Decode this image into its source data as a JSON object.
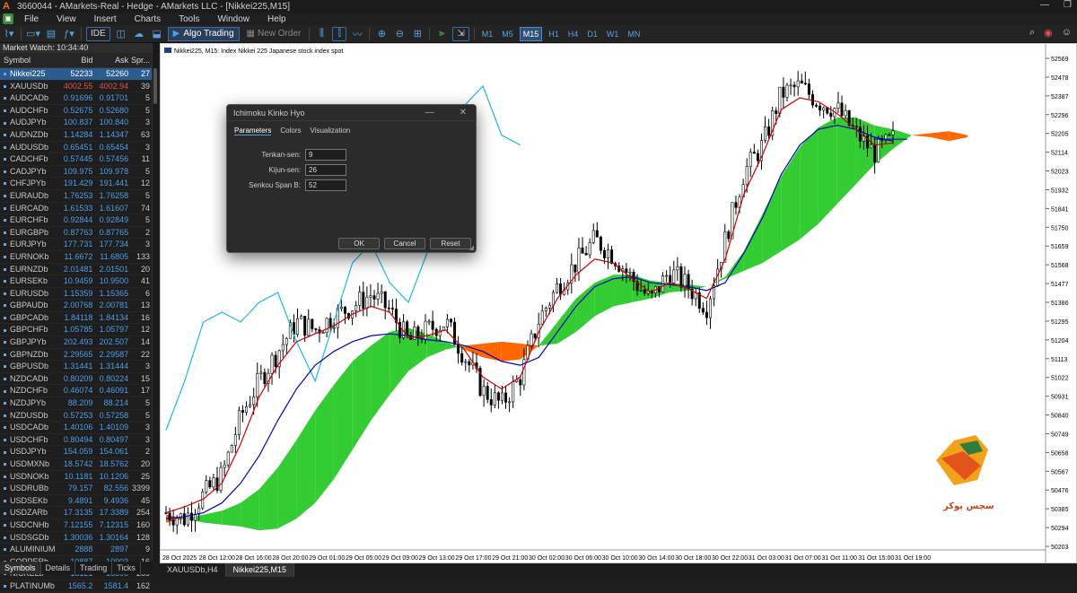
{
  "window": {
    "title": "3660044 - AMarkets-Real - Hedge - AMarkets LLC - [Nikkei225,M15]",
    "icon": "amarkets-logo-icon"
  },
  "menu": [
    "File",
    "View",
    "Insert",
    "Charts",
    "Tools",
    "Window",
    "Help"
  ],
  "toolbar": {
    "ide_label": "IDE",
    "algo_label": "Algo Trading",
    "new_order_label": "New Order",
    "timeframes": [
      "M1",
      "M5",
      "M15",
      "H1",
      "H4",
      "D1",
      "W1",
      "MN"
    ],
    "active_timeframe": "M15"
  },
  "market_watch": {
    "title": "Market Watch: 10:34:40",
    "columns": [
      "Symbol",
      "Bid",
      "Ask",
      "Spr..."
    ],
    "rows": [
      {
        "symbol": "Nikkei225",
        "bid": "52233",
        "ask": "52260",
        "spread": "27",
        "selected": true
      },
      {
        "symbol": "XAUUSDb",
        "bid": "4002.55",
        "ask": "4002.94",
        "spread": "39",
        "down": true
      },
      {
        "symbol": "AUDCADb",
        "bid": "0.91696",
        "ask": "0.91701",
        "spread": "5"
      },
      {
        "symbol": "AUDCHFb",
        "bid": "0.52675",
        "ask": "0.52680",
        "spread": "5"
      },
      {
        "symbol": "AUDJPYb",
        "bid": "100.837",
        "ask": "100.840",
        "spread": "3"
      },
      {
        "symbol": "AUDNZDb",
        "bid": "1.14284",
        "ask": "1.14347",
        "spread": "63"
      },
      {
        "symbol": "AUDUSDb",
        "bid": "0.65451",
        "ask": "0.65454",
        "spread": "3"
      },
      {
        "symbol": "CADCHFb",
        "bid": "0.57445",
        "ask": "0.57456",
        "spread": "11"
      },
      {
        "symbol": "CADJPYb",
        "bid": "109.975",
        "ask": "109.978",
        "spread": "5"
      },
      {
        "symbol": "CHFJPYb",
        "bid": "191.429",
        "ask": "191.441",
        "spread": "12"
      },
      {
        "symbol": "EURAUDb",
        "bid": "1.76253",
        "ask": "1.76258",
        "spread": "5"
      },
      {
        "symbol": "EURCADb",
        "bid": "1.61533",
        "ask": "1.61607",
        "spread": "74"
      },
      {
        "symbol": "EURCHFb",
        "bid": "0.92844",
        "ask": "0.92849",
        "spread": "5"
      },
      {
        "symbol": "EURGBPb",
        "bid": "0.87763",
        "ask": "0.87765",
        "spread": "2"
      },
      {
        "symbol": "EURJPYb",
        "bid": "177.731",
        "ask": "177.734",
        "spread": "3"
      },
      {
        "symbol": "EURNOKb",
        "bid": "11.6672",
        "ask": "11.6805",
        "spread": "133"
      },
      {
        "symbol": "EURNZDb",
        "bid": "2.01481",
        "ask": "2.01501",
        "spread": "20"
      },
      {
        "symbol": "EURSEKb",
        "bid": "10.9459",
        "ask": "10.9500",
        "spread": "41"
      },
      {
        "symbol": "EURUSDb",
        "bid": "1.15359",
        "ask": "1.15365",
        "spread": "6"
      },
      {
        "symbol": "GBPAUDb",
        "bid": "2.00768",
        "ask": "2.00781",
        "spread": "13"
      },
      {
        "symbol": "GBPCADb",
        "bid": "1.84118",
        "ask": "1.84134",
        "spread": "16"
      },
      {
        "symbol": "GBPCHFb",
        "bid": "1.05785",
        "ask": "1.05797",
        "spread": "12"
      },
      {
        "symbol": "GBPJPYb",
        "bid": "202.493",
        "ask": "202.507",
        "spread": "14"
      },
      {
        "symbol": "GBPNZDb",
        "bid": "2.29565",
        "ask": "2.29587",
        "spread": "22"
      },
      {
        "symbol": "GBPUSDb",
        "bid": "1.31441",
        "ask": "1.31444",
        "spread": "3"
      },
      {
        "symbol": "NZDCADb",
        "bid": "0.80209",
        "ask": "0.80224",
        "spread": "15"
      },
      {
        "symbol": "NZDCHFb",
        "bid": "0.46074",
        "ask": "0.46091",
        "spread": "17"
      },
      {
        "symbol": "NZDJPYb",
        "bid": "88.209",
        "ask": "88.214",
        "spread": "5"
      },
      {
        "symbol": "NZDUSDb",
        "bid": "0.57253",
        "ask": "0.57258",
        "spread": "5"
      },
      {
        "symbol": "USDCADb",
        "bid": "1.40106",
        "ask": "1.40109",
        "spread": "3"
      },
      {
        "symbol": "USDCHFb",
        "bid": "0.80494",
        "ask": "0.80497",
        "spread": "3"
      },
      {
        "symbol": "USDJPYb",
        "bid": "154.059",
        "ask": "154.061",
        "spread": "2"
      },
      {
        "symbol": "USDMXNb",
        "bid": "18.5742",
        "ask": "18.5762",
        "spread": "20"
      },
      {
        "symbol": "USDNOKb",
        "bid": "10.1181",
        "ask": "10.1206",
        "spread": "25"
      },
      {
        "symbol": "USDRUBb",
        "bid": "79.157",
        "ask": "82.556",
        "spread": "3399"
      },
      {
        "symbol": "USDSEKb",
        "bid": "9.4891",
        "ask": "9.4936",
        "spread": "45"
      },
      {
        "symbol": "USDZARb",
        "bid": "17.3135",
        "ask": "17.3389",
        "spread": "254"
      },
      {
        "symbol": "USDCNHb",
        "bid": "7.12155",
        "ask": "7.12315",
        "spread": "160"
      },
      {
        "symbol": "USDSGDb",
        "bid": "1.30036",
        "ask": "1.30164",
        "spread": "128"
      },
      {
        "symbol": "ALUMINIUMb",
        "bid": "2888",
        "ask": "2897",
        "spread": "9"
      },
      {
        "symbol": "COPPERb",
        "bid": "10887",
        "ask": "10903",
        "spread": "16"
      },
      {
        "symbol": "NICKELb",
        "bid": "15121",
        "ask": "15390",
        "spread": "269"
      },
      {
        "symbol": "PLATINUMb",
        "bid": "1565.2",
        "ask": "1581.4",
        "spread": "162"
      }
    ],
    "tabs": [
      "Symbols",
      "Details",
      "Trading",
      "Ticks"
    ],
    "active_tab": "Symbols"
  },
  "chart_tabs": [
    "XAUUSDb,H4",
    "Nikkei225,M15"
  ],
  "active_chart_tab": "Nikkei225,M15",
  "chart_data": {
    "type": "candlestick",
    "title": "Nikkei225, M15:  Index Nikkei 225 Japanese stock index spot",
    "indicator": "Ichimoku Kinko Hyo",
    "y_ticks": [
      "52569",
      "52478",
      "52387",
      "52296",
      "52205",
      "52114",
      "52023",
      "51932",
      "51841",
      "51750",
      "51659",
      "51568",
      "51477",
      "51386",
      "51295",
      "51204",
      "51113",
      "51022",
      "50931",
      "50840",
      "50749",
      "50658",
      "50567",
      "50476",
      "50385",
      "50294",
      "50203"
    ],
    "ylim": [
      50203,
      52569
    ],
    "x_ticks": [
      "28 Oct 2025",
      "28 Oct 12:00",
      "28 Oct 16:00",
      "28 Oct 20:00",
      "29 Oct 01:00",
      "29 Oct 05:00",
      "29 Oct 09:00",
      "29 Oct 13:00",
      "29 Oct 17:00",
      "29 Oct 21:00",
      "30 Oct 02:00",
      "30 Oct 06:00",
      "30 Oct 10:00",
      "30 Oct 14:00",
      "30 Oct 18:00",
      "30 Oct 22:00",
      "31 Oct 03:00",
      "31 Oct 07:00",
      "31 Oct 11:00",
      "31 Oct 15:00",
      "31 Oct 19:00"
    ],
    "series": [
      {
        "name": "Price",
        "color": "#000000",
        "values": [
          50330,
          50300,
          50420,
          50520,
          50820,
          51000,
          51150,
          51300,
          51260,
          51330,
          51380,
          51440,
          51360,
          51200,
          51260,
          51300,
          51130,
          50950,
          50880,
          51020,
          51310,
          51480,
          51600,
          51720,
          51640,
          51520,
          51410,
          51560,
          51480,
          51380,
          51720,
          52060,
          52200,
          52460,
          52500,
          52420,
          52380,
          52260,
          52160,
          52230
        ]
      },
      {
        "name": "Tenkan-sen",
        "color": "#d00000",
        "values": [
          50330,
          50360,
          50400,
          50480,
          50680,
          50920,
          51080,
          51200,
          51240,
          51280,
          51340,
          51380,
          51350,
          51220,
          51230,
          51260,
          51160,
          51020,
          50960,
          51020,
          51250,
          51420,
          51540,
          51620,
          51600,
          51520,
          51450,
          51500,
          51470,
          51420,
          51620,
          51950,
          52150,
          52380,
          52440,
          52420,
          52360,
          52280,
          52200,
          52210
        ]
      },
      {
        "name": "Kijun-sen",
        "color": "#0000c0",
        "values": [
          50300,
          50310,
          50330,
          50380,
          50480,
          50620,
          50800,
          50960,
          51080,
          51150,
          51200,
          51230,
          51240,
          51230,
          51210,
          51200,
          51180,
          51150,
          51100,
          51080,
          51120,
          51250,
          51380,
          51480,
          51520,
          51530,
          51500,
          51490,
          51480,
          51460,
          51500,
          51650,
          51830,
          52050,
          52200,
          52280,
          52300,
          52280,
          52240,
          52220
        ]
      },
      {
        "name": "Chikou Span",
        "color": "#20b8e0",
        "values": [
          50750,
          51000,
          51300,
          51350,
          51300,
          51400,
          51450,
          51200,
          51000,
          51300,
          51600,
          51700,
          51500,
          51400,
          51650,
          52100,
          52400,
          52500,
          52250,
          52200
        ]
      },
      {
        "name": "Senkou Span A",
        "color": "#33cc33",
        "values": [
          50280,
          50300,
          50320,
          50340,
          50380,
          50450,
          50560,
          50700,
          50850,
          50980,
          51100,
          51180,
          51250,
          51270,
          51240,
          51200,
          51160,
          51120,
          51100,
          51110,
          51180,
          51300,
          51420,
          51500,
          51540,
          51540,
          51510,
          51500,
          51490,
          51480,
          51530,
          51660,
          51850,
          52040,
          52190,
          52290,
          52340,
          52340,
          52300,
          52280,
          52250,
          52240,
          52220,
          52240
        ]
      },
      {
        "name": "Senkou Span B",
        "color": "#ff6600",
        "values": [
          50320,
          50300,
          50280,
          50270,
          50260,
          50240,
          50250,
          50300,
          50380,
          50500,
          50650,
          50800,
          50930,
          51050,
          51120,
          51160,
          51180,
          51190,
          51200,
          51190,
          51180,
          51190,
          51250,
          51330,
          51380,
          51400,
          51420,
          51450,
          51460,
          51480,
          51520,
          51560,
          51600,
          51660,
          51720,
          51800,
          51900,
          52000,
          52100,
          52180,
          52250,
          52260,
          52270,
          52250
        ]
      }
    ],
    "logo_text": "سچس پوکر"
  },
  "dialog": {
    "title": "Ichimoku Kinko Hyo",
    "tabs": [
      "Parameters",
      "Colors",
      "Visualization"
    ],
    "active_tab": "Parameters",
    "fields": [
      {
        "label": "Tenkan-sen:",
        "value": "9"
      },
      {
        "label": "Kijun-sen:",
        "value": "26"
      },
      {
        "label": "Senkou Span B:",
        "value": "52"
      }
    ],
    "ok_label": "OK",
    "cancel_label": "Cancel",
    "reset_label": "Reset"
  }
}
